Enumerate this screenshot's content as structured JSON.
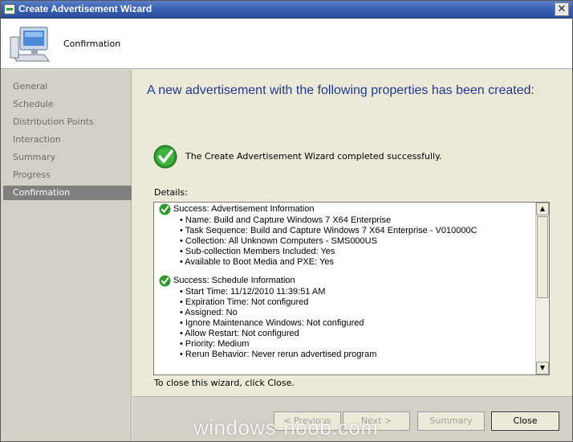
{
  "window": {
    "title": "Create Advertisement Wizard",
    "close_glyph": "✕"
  },
  "header": {
    "title": "Confirmation"
  },
  "sidebar": {
    "items": [
      {
        "label": "General",
        "active": false
      },
      {
        "label": "Schedule",
        "active": false
      },
      {
        "label": "Distribution Points",
        "active": false
      },
      {
        "label": "Interaction",
        "active": false
      },
      {
        "label": "Summary",
        "active": false
      },
      {
        "label": "Progress",
        "active": false
      },
      {
        "label": "Confirmation",
        "active": true
      }
    ]
  },
  "main": {
    "heading": "A new advertisement with the following properties has been created:",
    "success_message": "The Create Advertisement Wizard completed successfully.",
    "details_label": "Details:",
    "details": {
      "sections": [
        {
          "title": "Success: Advertisement Information",
          "items": [
            "• Name: Build and Capture Windows 7 X64 Enterprise",
            "• Task Sequence: Build and Capture Windows 7 X64 Enterprise - V010000C",
            "• Collection: All Unknown Computers - SMS000US",
            "• Sub-collection Members Included: Yes",
            "• Available to Boot Media and PXE: Yes"
          ]
        },
        {
          "title": "Success: Schedule Information",
          "items": [
            "• Start Time: 11/12/2010 11:39:51 AM",
            "• Expiration Time: Not configured",
            "• Assigned: No",
            "• Ignore Maintenance Windows: Not configured",
            "• Allow Restart: Not configured",
            "• Priority: Medium",
            "• Rerun Behavior: Never rerun advertised program"
          ]
        }
      ]
    },
    "close_hint": "To close this wizard, click Close."
  },
  "footer": {
    "previous_label": "< Previous",
    "next_label": "Next >",
    "summary_label": "Summary",
    "close_label": "Close"
  },
  "watermark": "windows-noob.com",
  "colors": {
    "heading": "#1f3a93",
    "active_nav": "#7f7f80",
    "success_green": "#2e9a2e"
  }
}
